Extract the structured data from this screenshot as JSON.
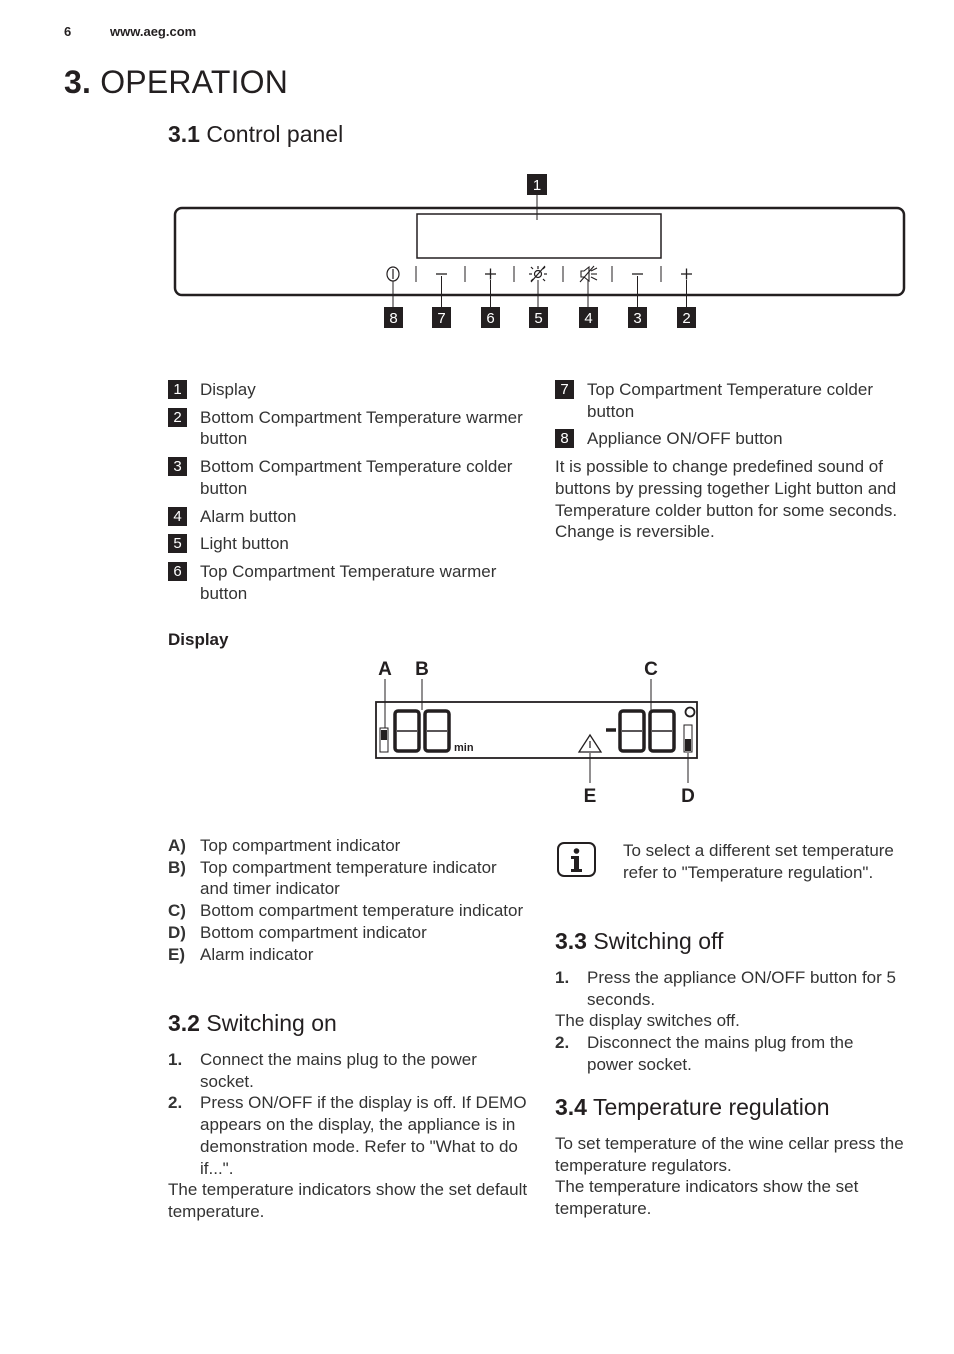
{
  "header": {
    "page_number": "6",
    "site": "www.aeg.com"
  },
  "section": {
    "number": "3.",
    "title": "OPERATION"
  },
  "control_panel": {
    "heading_number": "3.1",
    "heading_title": "Control panel",
    "callouts": {
      "display": "1",
      "buttons": [
        "8",
        "7",
        "6",
        "5",
        "4",
        "3",
        "2"
      ]
    },
    "button_icons": [
      "power-icon",
      "minus-icon",
      "plus-icon",
      "light-icon",
      "alarm-mute-icon",
      "minus-icon",
      "plus-icon"
    ],
    "button_glyphs": [
      "⏻",
      "–",
      "+",
      "☀",
      "🔇",
      "–",
      "+"
    ],
    "legend_left": [
      {
        "n": "1",
        "text": "Display"
      },
      {
        "n": "2",
        "text": "Bottom Compartment Temperature warmer button"
      },
      {
        "n": "3",
        "text": "Bottom Compartment Temperature colder button"
      },
      {
        "n": "4",
        "text": "Alarm button"
      },
      {
        "n": "5",
        "text": "Light button"
      },
      {
        "n": "6",
        "text": "Top Compartment Temperature warmer button"
      }
    ],
    "legend_right": [
      {
        "n": "7",
        "text": "Top Compartment Temperature colder button"
      },
      {
        "n": "8",
        "text": "Appliance ON/OFF button"
      }
    ],
    "note": "It is possible to change predefined sound of buttons by pressing together Light button and Temperature colder button for some seconds. Change is reversible."
  },
  "display": {
    "subheading": "Display",
    "labels": {
      "A": "A",
      "B": "B",
      "C": "C",
      "D": "D",
      "E": "E"
    },
    "left_digits": "88",
    "right_digits": "-88",
    "unit_min": "min",
    "degree": "°",
    "legend": [
      {
        "key": "A)",
        "text": "Top compartment indicator"
      },
      {
        "key": "B)",
        "text": "Top compartment temperature indicator and timer indicator"
      },
      {
        "key": "C)",
        "text": "Bottom compartment temperature indicator"
      },
      {
        "key": "D)",
        "text": "Bottom compartment indicator"
      },
      {
        "key": "E)",
        "text": "Alarm indicator"
      }
    ],
    "info_note": "To select a different set temperature refer to \"Temperature regulation\"."
  },
  "switching_on": {
    "heading_number": "3.2",
    "heading_title": "Switching on",
    "steps": [
      {
        "n": "1.",
        "text": "Connect the mains plug to the power socket."
      },
      {
        "n": "2.",
        "text": "Press ON/OFF if the display is off. If DEMO appears on the display, the appliance is in demonstration mode. Refer to \"What to do if...\"."
      }
    ],
    "after": "The temperature indicators show the set default temperature."
  },
  "switching_off": {
    "heading_number": "3.3",
    "heading_title": "Switching off",
    "step1": {
      "n": "1.",
      "text": "Press the appliance ON/OFF button for 5 seconds."
    },
    "middle": "The display switches off.",
    "step2": {
      "n": "2.",
      "text": "Disconnect the mains plug from the power socket."
    }
  },
  "temperature_regulation": {
    "heading_number": "3.4",
    "heading_title": "Temperature regulation",
    "text1": "To set temperature of the wine cellar press the temperature regulators.",
    "text2": "The temperature indicators show the set temperature."
  }
}
